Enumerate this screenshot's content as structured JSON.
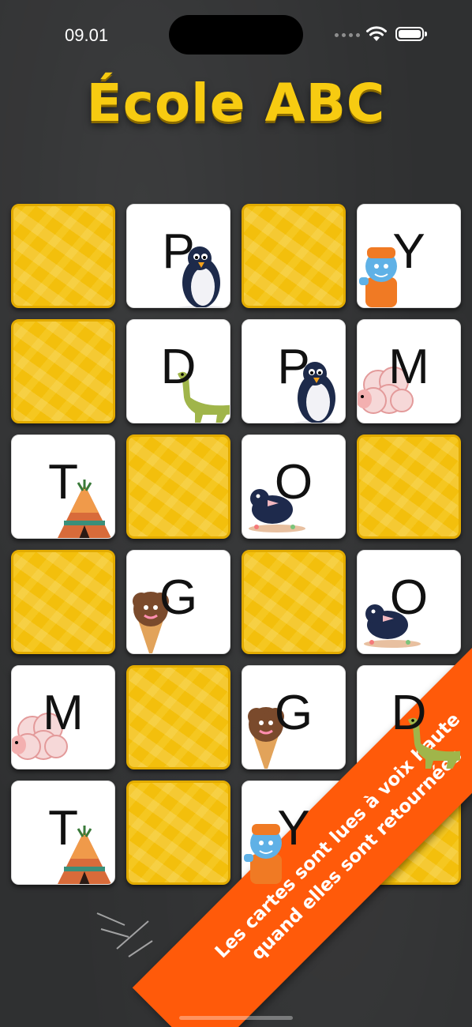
{
  "status": {
    "time": "09.01"
  },
  "title": "École ABC",
  "banner": {
    "line1": "Les cartes sont lues à voix haute",
    "line2": "quand elles sont retournées"
  },
  "colors": {
    "accent": "#f7cb11",
    "card_back": "#f3bf0c",
    "banner": "#ff5a0a",
    "background": "#2f3031"
  },
  "board": {
    "rows": 6,
    "cols": 4,
    "cards": [
      {
        "state": "hidden"
      },
      {
        "state": "revealed",
        "letter": "P",
        "picture": "penguin-icon"
      },
      {
        "state": "hidden"
      },
      {
        "state": "revealed",
        "letter": "Y",
        "picture": "yeti-icon"
      },
      {
        "state": "hidden"
      },
      {
        "state": "revealed",
        "letter": "D",
        "picture": "dinosaur-icon"
      },
      {
        "state": "revealed",
        "letter": "P",
        "picture": "penguin-icon"
      },
      {
        "state": "revealed",
        "letter": "M",
        "picture": "sheep-icon"
      },
      {
        "state": "revealed",
        "letter": "T",
        "picture": "teepee-icon"
      },
      {
        "state": "hidden"
      },
      {
        "state": "revealed",
        "letter": "O",
        "picture": "bird-icon"
      },
      {
        "state": "hidden"
      },
      {
        "state": "hidden"
      },
      {
        "state": "revealed",
        "letter": "G",
        "picture": "ice-cream-icon"
      },
      {
        "state": "hidden"
      },
      {
        "state": "revealed",
        "letter": "O",
        "picture": "bird-icon"
      },
      {
        "state": "revealed",
        "letter": "M",
        "picture": "sheep-icon"
      },
      {
        "state": "hidden"
      },
      {
        "state": "revealed",
        "letter": "G",
        "picture": "ice-cream-icon"
      },
      {
        "state": "revealed",
        "letter": "D",
        "picture": "dinosaur-icon"
      },
      {
        "state": "revealed",
        "letter": "T",
        "picture": "teepee-icon"
      },
      {
        "state": "hidden"
      },
      {
        "state": "revealed",
        "letter": "Y",
        "picture": "yeti-icon"
      },
      {
        "state": "hidden"
      }
    ]
  }
}
